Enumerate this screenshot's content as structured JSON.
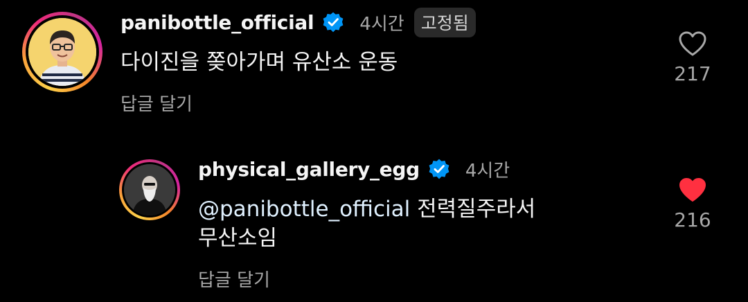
{
  "comments": [
    {
      "username": "panibottle_official",
      "verified": true,
      "time": "4시간",
      "badge": "고정됨",
      "text_lines": [
        "다이진을 쫒아가며 유산소 운동"
      ],
      "reply_label": "답글 달기",
      "likes": "217",
      "liked": false,
      "avatar_icon": "person-glasses-avatar"
    },
    {
      "username": "physical_gallery_egg",
      "verified": true,
      "time": "4시간",
      "mention": "@panibottle_official",
      "text_lines": [
        "@panibottle_official 전력질주라서",
        "무산소임"
      ],
      "text_tail": " 전력질주라서",
      "reply_label": "답글 달기",
      "likes": "216",
      "liked": true,
      "avatar_icon": "bearded-man-avatar"
    }
  ],
  "colors": {
    "background": "#000000",
    "text_primary": "#f5f5f5",
    "text_secondary": "#a8a8a8",
    "verified_blue": "#0095f6",
    "heart_red": "#ff3040",
    "badge_bg": "#2a2a2a"
  }
}
